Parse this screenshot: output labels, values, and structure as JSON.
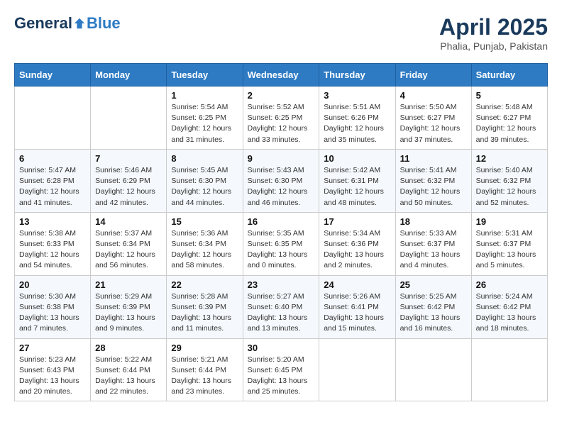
{
  "header": {
    "logo_general": "General",
    "logo_blue": "Blue",
    "month": "April 2025",
    "location": "Phalia, Punjab, Pakistan"
  },
  "weekdays": [
    "Sunday",
    "Monday",
    "Tuesday",
    "Wednesday",
    "Thursday",
    "Friday",
    "Saturday"
  ],
  "weeks": [
    [
      {
        "day": "",
        "info": ""
      },
      {
        "day": "",
        "info": ""
      },
      {
        "day": "1",
        "info": "Sunrise: 5:54 AM\nSunset: 6:25 PM\nDaylight: 12 hours and 31 minutes."
      },
      {
        "day": "2",
        "info": "Sunrise: 5:52 AM\nSunset: 6:25 PM\nDaylight: 12 hours and 33 minutes."
      },
      {
        "day": "3",
        "info": "Sunrise: 5:51 AM\nSunset: 6:26 PM\nDaylight: 12 hours and 35 minutes."
      },
      {
        "day": "4",
        "info": "Sunrise: 5:50 AM\nSunset: 6:27 PM\nDaylight: 12 hours and 37 minutes."
      },
      {
        "day": "5",
        "info": "Sunrise: 5:48 AM\nSunset: 6:27 PM\nDaylight: 12 hours and 39 minutes."
      }
    ],
    [
      {
        "day": "6",
        "info": "Sunrise: 5:47 AM\nSunset: 6:28 PM\nDaylight: 12 hours and 41 minutes."
      },
      {
        "day": "7",
        "info": "Sunrise: 5:46 AM\nSunset: 6:29 PM\nDaylight: 12 hours and 42 minutes."
      },
      {
        "day": "8",
        "info": "Sunrise: 5:45 AM\nSunset: 6:30 PM\nDaylight: 12 hours and 44 minutes."
      },
      {
        "day": "9",
        "info": "Sunrise: 5:43 AM\nSunset: 6:30 PM\nDaylight: 12 hours and 46 minutes."
      },
      {
        "day": "10",
        "info": "Sunrise: 5:42 AM\nSunset: 6:31 PM\nDaylight: 12 hours and 48 minutes."
      },
      {
        "day": "11",
        "info": "Sunrise: 5:41 AM\nSunset: 6:32 PM\nDaylight: 12 hours and 50 minutes."
      },
      {
        "day": "12",
        "info": "Sunrise: 5:40 AM\nSunset: 6:32 PM\nDaylight: 12 hours and 52 minutes."
      }
    ],
    [
      {
        "day": "13",
        "info": "Sunrise: 5:38 AM\nSunset: 6:33 PM\nDaylight: 12 hours and 54 minutes."
      },
      {
        "day": "14",
        "info": "Sunrise: 5:37 AM\nSunset: 6:34 PM\nDaylight: 12 hours and 56 minutes."
      },
      {
        "day": "15",
        "info": "Sunrise: 5:36 AM\nSunset: 6:34 PM\nDaylight: 12 hours and 58 minutes."
      },
      {
        "day": "16",
        "info": "Sunrise: 5:35 AM\nSunset: 6:35 PM\nDaylight: 13 hours and 0 minutes."
      },
      {
        "day": "17",
        "info": "Sunrise: 5:34 AM\nSunset: 6:36 PM\nDaylight: 13 hours and 2 minutes."
      },
      {
        "day": "18",
        "info": "Sunrise: 5:33 AM\nSunset: 6:37 PM\nDaylight: 13 hours and 4 minutes."
      },
      {
        "day": "19",
        "info": "Sunrise: 5:31 AM\nSunset: 6:37 PM\nDaylight: 13 hours and 5 minutes."
      }
    ],
    [
      {
        "day": "20",
        "info": "Sunrise: 5:30 AM\nSunset: 6:38 PM\nDaylight: 13 hours and 7 minutes."
      },
      {
        "day": "21",
        "info": "Sunrise: 5:29 AM\nSunset: 6:39 PM\nDaylight: 13 hours and 9 minutes."
      },
      {
        "day": "22",
        "info": "Sunrise: 5:28 AM\nSunset: 6:39 PM\nDaylight: 13 hours and 11 minutes."
      },
      {
        "day": "23",
        "info": "Sunrise: 5:27 AM\nSunset: 6:40 PM\nDaylight: 13 hours and 13 minutes."
      },
      {
        "day": "24",
        "info": "Sunrise: 5:26 AM\nSunset: 6:41 PM\nDaylight: 13 hours and 15 minutes."
      },
      {
        "day": "25",
        "info": "Sunrise: 5:25 AM\nSunset: 6:42 PM\nDaylight: 13 hours and 16 minutes."
      },
      {
        "day": "26",
        "info": "Sunrise: 5:24 AM\nSunset: 6:42 PM\nDaylight: 13 hours and 18 minutes."
      }
    ],
    [
      {
        "day": "27",
        "info": "Sunrise: 5:23 AM\nSunset: 6:43 PM\nDaylight: 13 hours and 20 minutes."
      },
      {
        "day": "28",
        "info": "Sunrise: 5:22 AM\nSunset: 6:44 PM\nDaylight: 13 hours and 22 minutes."
      },
      {
        "day": "29",
        "info": "Sunrise: 5:21 AM\nSunset: 6:44 PM\nDaylight: 13 hours and 23 minutes."
      },
      {
        "day": "30",
        "info": "Sunrise: 5:20 AM\nSunset: 6:45 PM\nDaylight: 13 hours and 25 minutes."
      },
      {
        "day": "",
        "info": ""
      },
      {
        "day": "",
        "info": ""
      },
      {
        "day": "",
        "info": ""
      }
    ]
  ]
}
